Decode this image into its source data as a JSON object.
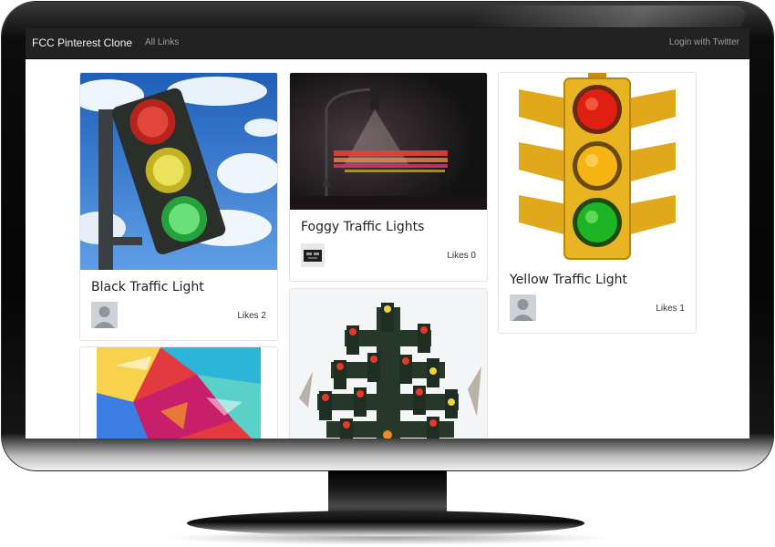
{
  "navbar": {
    "brand": "FCC Pinterest Clone",
    "all_links": "All Links",
    "login": "Login with Twitter"
  },
  "cards": [
    {
      "title": "Black Traffic Light",
      "likes": "Likes 2",
      "image": "traffic-light-sky-photo",
      "avatar": "default-user-icon"
    },
    {
      "title": "Foggy Traffic Lights",
      "likes": "Likes 0",
      "image": "foggy-traffic-lights-photo",
      "avatar": "user-photo"
    },
    {
      "title": "Yellow Traffic Light",
      "likes": "Likes 1",
      "image": "yellow-traffic-light-photo",
      "avatar": "default-user-icon"
    },
    {
      "image": "abstract-painting-photo"
    },
    {
      "image": "traffic-light-tree-photo"
    }
  ],
  "colors": {
    "navbar_bg": "#222222",
    "navbar_brand": "#f2f2f2",
    "navbar_link": "#9d9d9d",
    "card_border": "#e4e4e4"
  }
}
